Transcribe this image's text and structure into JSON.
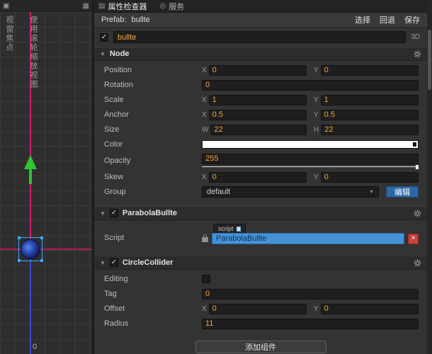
{
  "icons": {
    "panel": "▣",
    "grid": "▦",
    "inspector_tab": "▤",
    "services_tab": "◎",
    "collapse": "▼",
    "check": "✓",
    "caret": "▼",
    "close": "×"
  },
  "scene": {
    "hint_focus": "视窗焦点",
    "hint_zoom": "使用滚轮缩放视图",
    "origin_label": "0"
  },
  "inspector": {
    "tabs": {
      "inspector": "属性检查器",
      "services": "服务"
    },
    "prefab": {
      "label": "Prefab:",
      "name": "bullte",
      "select": "选择",
      "revert": "回退",
      "save": "保存"
    },
    "name": {
      "value": "bullte",
      "mode_3d": "3D"
    },
    "axis": {
      "x": "X",
      "y": "Y",
      "w": "W",
      "h": "H"
    },
    "node": {
      "title": "Node",
      "position": {
        "label": "Position",
        "x": "0",
        "y": "0"
      },
      "rotation": {
        "label": "Rotation",
        "value": "0"
      },
      "scale": {
        "label": "Scale",
        "x": "1",
        "y": "1"
      },
      "anchor": {
        "label": "Anchor",
        "x": "0.5",
        "y": "0.5"
      },
      "size": {
        "label": "Size",
        "w": "22",
        "h": "22"
      },
      "color": {
        "label": "Color",
        "value": "#ffffff"
      },
      "opacity": {
        "label": "Opacity",
        "value": "255"
      },
      "skew": {
        "label": "Skew",
        "x": "0",
        "y": "0"
      },
      "group": {
        "label": "Group",
        "value": "default",
        "edit_label": "编辑"
      }
    },
    "parabola": {
      "title": "ParabolaBullte",
      "script": {
        "label": "Script",
        "badge": "script",
        "value": "ParabolaBullte"
      }
    },
    "collider": {
      "title": "CircleCollider",
      "editing": {
        "label": "Editing"
      },
      "tag": {
        "label": "Tag",
        "value": "0"
      },
      "offset": {
        "label": "Offset",
        "x": "0",
        "y": "0"
      },
      "radius": {
        "label": "Radius",
        "value": "11"
      }
    },
    "add_component_label": "添加组件"
  },
  "colors": {
    "accent_orange": "#f8a33b",
    "highlight_blue": "#4593d6",
    "edit_button_blue": "#2d68a6",
    "remove_red": "#c9403c",
    "node_color": "#ffffff",
    "selection_cyan": "#3fa9ff",
    "gizmo_green": "#2fc62f",
    "axis_magenta": "#cf1f6e",
    "axis_blue": "#3c49c8"
  }
}
